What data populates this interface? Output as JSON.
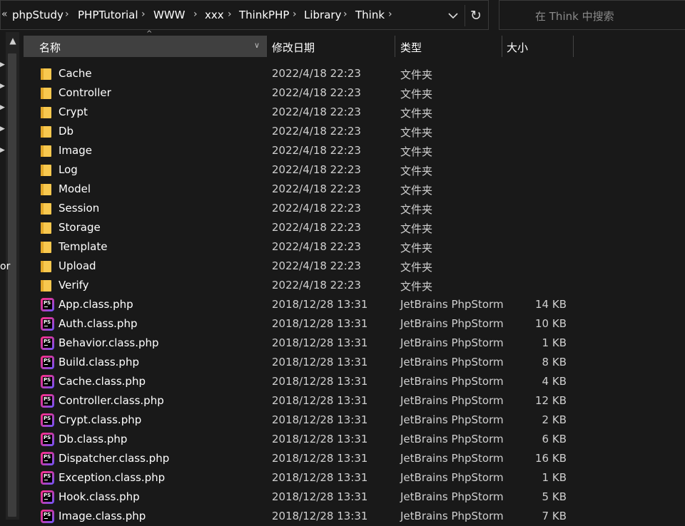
{
  "breadcrumb": [
    {
      "label": "phpStudy"
    },
    {
      "label": "PHPTutorial"
    },
    {
      "label": "WWW"
    },
    {
      "label": "xxx"
    },
    {
      "label": "ThinkPHP"
    },
    {
      "label": "Library"
    },
    {
      "label": "Think"
    }
  ],
  "search": {
    "placeholder": "在 Think 中搜索"
  },
  "nav": {
    "fragment": "or"
  },
  "columns": {
    "name": "名称",
    "date": "修改日期",
    "type": "类型",
    "size": "大小"
  },
  "files": [
    {
      "name": "Cache",
      "date": "2022/4/18 22:23",
      "type": "文件夹",
      "size": "",
      "icon": "folder-icon"
    },
    {
      "name": "Controller",
      "date": "2022/4/18 22:23",
      "type": "文件夹",
      "size": "",
      "icon": "folder-icon"
    },
    {
      "name": "Crypt",
      "date": "2022/4/18 22:23",
      "type": "文件夹",
      "size": "",
      "icon": "folder-icon"
    },
    {
      "name": "Db",
      "date": "2022/4/18 22:23",
      "type": "文件夹",
      "size": "",
      "icon": "folder-icon"
    },
    {
      "name": "Image",
      "date": "2022/4/18 22:23",
      "type": "文件夹",
      "size": "",
      "icon": "folder-icon"
    },
    {
      "name": "Log",
      "date": "2022/4/18 22:23",
      "type": "文件夹",
      "size": "",
      "icon": "folder-icon"
    },
    {
      "name": "Model",
      "date": "2022/4/18 22:23",
      "type": "文件夹",
      "size": "",
      "icon": "folder-icon"
    },
    {
      "name": "Session",
      "date": "2022/4/18 22:23",
      "type": "文件夹",
      "size": "",
      "icon": "folder-icon"
    },
    {
      "name": "Storage",
      "date": "2022/4/18 22:23",
      "type": "文件夹",
      "size": "",
      "icon": "folder-icon"
    },
    {
      "name": "Template",
      "date": "2022/4/18 22:23",
      "type": "文件夹",
      "size": "",
      "icon": "folder-icon"
    },
    {
      "name": "Upload",
      "date": "2022/4/18 22:23",
      "type": "文件夹",
      "size": "",
      "icon": "folder-icon"
    },
    {
      "name": "Verify",
      "date": "2022/4/18 22:23",
      "type": "文件夹",
      "size": "",
      "icon": "folder-icon"
    },
    {
      "name": "App.class.php",
      "date": "2018/12/28 13:31",
      "type": "JetBrains PhpStorm",
      "size": "14 KB",
      "icon": "phpstorm-file-icon"
    },
    {
      "name": "Auth.class.php",
      "date": "2018/12/28 13:31",
      "type": "JetBrains PhpStorm",
      "size": "10 KB",
      "icon": "phpstorm-file-icon"
    },
    {
      "name": "Behavior.class.php",
      "date": "2018/12/28 13:31",
      "type": "JetBrains PhpStorm",
      "size": "1 KB",
      "icon": "phpstorm-file-icon"
    },
    {
      "name": "Build.class.php",
      "date": "2018/12/28 13:31",
      "type": "JetBrains PhpStorm",
      "size": "8 KB",
      "icon": "phpstorm-file-icon"
    },
    {
      "name": "Cache.class.php",
      "date": "2018/12/28 13:31",
      "type": "JetBrains PhpStorm",
      "size": "4 KB",
      "icon": "phpstorm-file-icon"
    },
    {
      "name": "Controller.class.php",
      "date": "2018/12/28 13:31",
      "type": "JetBrains PhpStorm",
      "size": "12 KB",
      "icon": "phpstorm-file-icon"
    },
    {
      "name": "Crypt.class.php",
      "date": "2018/12/28 13:31",
      "type": "JetBrains PhpStorm",
      "size": "2 KB",
      "icon": "phpstorm-file-icon"
    },
    {
      "name": "Db.class.php",
      "date": "2018/12/28 13:31",
      "type": "JetBrains PhpStorm",
      "size": "6 KB",
      "icon": "phpstorm-file-icon"
    },
    {
      "name": "Dispatcher.class.php",
      "date": "2018/12/28 13:31",
      "type": "JetBrains PhpStorm",
      "size": "16 KB",
      "icon": "phpstorm-file-icon"
    },
    {
      "name": "Exception.class.php",
      "date": "2018/12/28 13:31",
      "type": "JetBrains PhpStorm",
      "size": "1 KB",
      "icon": "phpstorm-file-icon"
    },
    {
      "name": "Hook.class.php",
      "date": "2018/12/28 13:31",
      "type": "JetBrains PhpStorm",
      "size": "5 KB",
      "icon": "phpstorm-file-icon"
    },
    {
      "name": "Image.class.php",
      "date": "2018/12/28 13:31",
      "type": "JetBrains PhpStorm",
      "size": "7 KB",
      "icon": "phpstorm-file-icon"
    }
  ],
  "colors": {
    "background": "#191919",
    "header_active": "#404040",
    "folder": "#f8c84f",
    "text": "#ffffff",
    "muted_text": "#cfcfcf"
  }
}
